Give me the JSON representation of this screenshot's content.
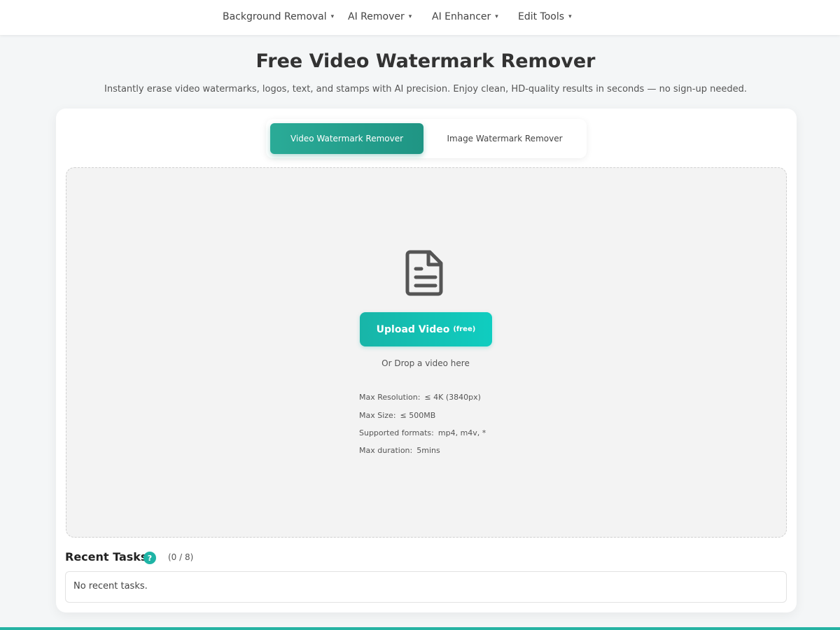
{
  "nav": {
    "items": [
      {
        "label": "Background Removal",
        "caret": "▾"
      },
      {
        "label": "AI Remover",
        "caret": "▾"
      },
      {
        "label": "AI Enhancer",
        "caret": "▾"
      },
      {
        "label": "Edit Tools",
        "caret": "▾"
      }
    ]
  },
  "hero": {
    "title": "Free Video Watermark Remover",
    "subtitle": "Instantly erase video watermarks, logos, text, and stamps with AI precision. Enjoy clean, HD-quality results in seconds — no sign-up needed."
  },
  "tabs": [
    {
      "label": "Video Watermark Remover",
      "active": true
    },
    {
      "label": "Image Watermark Remover",
      "active": false
    }
  ],
  "upload": {
    "icon": "document-icon",
    "button_label": "Upload Video",
    "button_free": "(free)",
    "drop_text": "Or Drop a video here",
    "specs": [
      {
        "label": "Max Resolution:",
        "value": "≤ 4K (3840px)"
      },
      {
        "label": "Max Size:",
        "value": "≤ 500MB"
      },
      {
        "label": "Supported formats:",
        "value": "mp4, m4v, *"
      },
      {
        "label": "Max duration:",
        "value": "5mins"
      }
    ]
  },
  "recent": {
    "title": "Recent Tasks",
    "help": "?",
    "count": "(0 / 8)",
    "empty": "No recent tasks."
  },
  "colors": {
    "accent": "#1eb4a6",
    "tab_active": "#2aab97"
  }
}
